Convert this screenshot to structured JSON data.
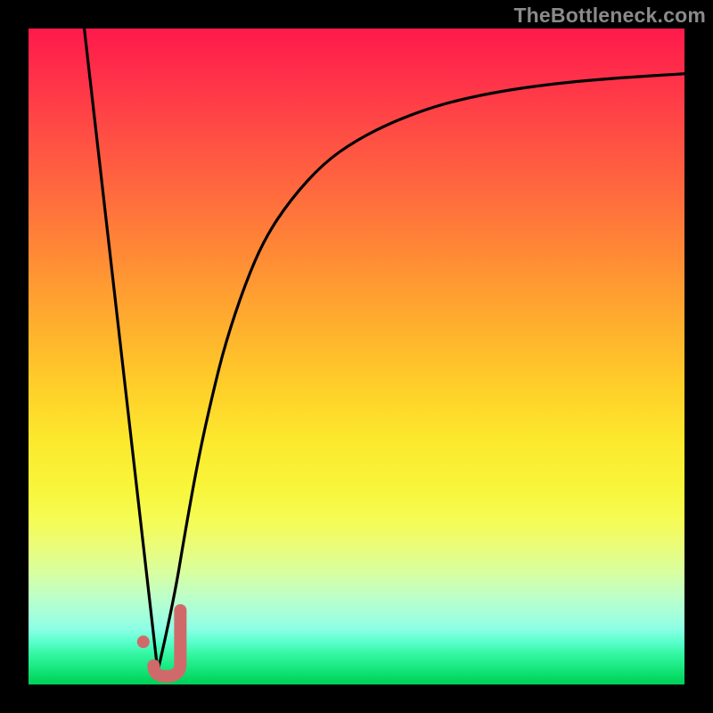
{
  "watermark": "TheBottleneck.com",
  "colors": {
    "curve_stroke": "#000000",
    "marker_stroke": "#d06a6a",
    "marker_fill": "#d06a6a",
    "frame": "#000000"
  },
  "chart_data": {
    "type": "line",
    "title": "",
    "xlabel": "",
    "ylabel": "",
    "xlim": [
      0,
      100
    ],
    "ylim": [
      0,
      100
    ],
    "grid": false,
    "series": [
      {
        "name": "left-slope",
        "x": [
          8.5,
          19.7
        ],
        "y": [
          100,
          2
        ]
      },
      {
        "name": "right-curve",
        "x": [
          19.7,
          22,
          24,
          26,
          28,
          30,
          33,
          36,
          40,
          45,
          50,
          56,
          63,
          71,
          80,
          90,
          100
        ],
        "y": [
          2,
          12,
          24,
          35,
          44,
          52,
          61,
          68,
          74,
          79.5,
          83,
          86,
          88.5,
          90.3,
          91.6,
          92.5,
          93.1
        ]
      }
    ],
    "markers": [
      {
        "name": "j-hook",
        "type": "path",
        "x_center": 20.7,
        "y_center": 4.5
      },
      {
        "name": "dot",
        "type": "point",
        "x": 17.5,
        "y": 6.5
      }
    ]
  }
}
